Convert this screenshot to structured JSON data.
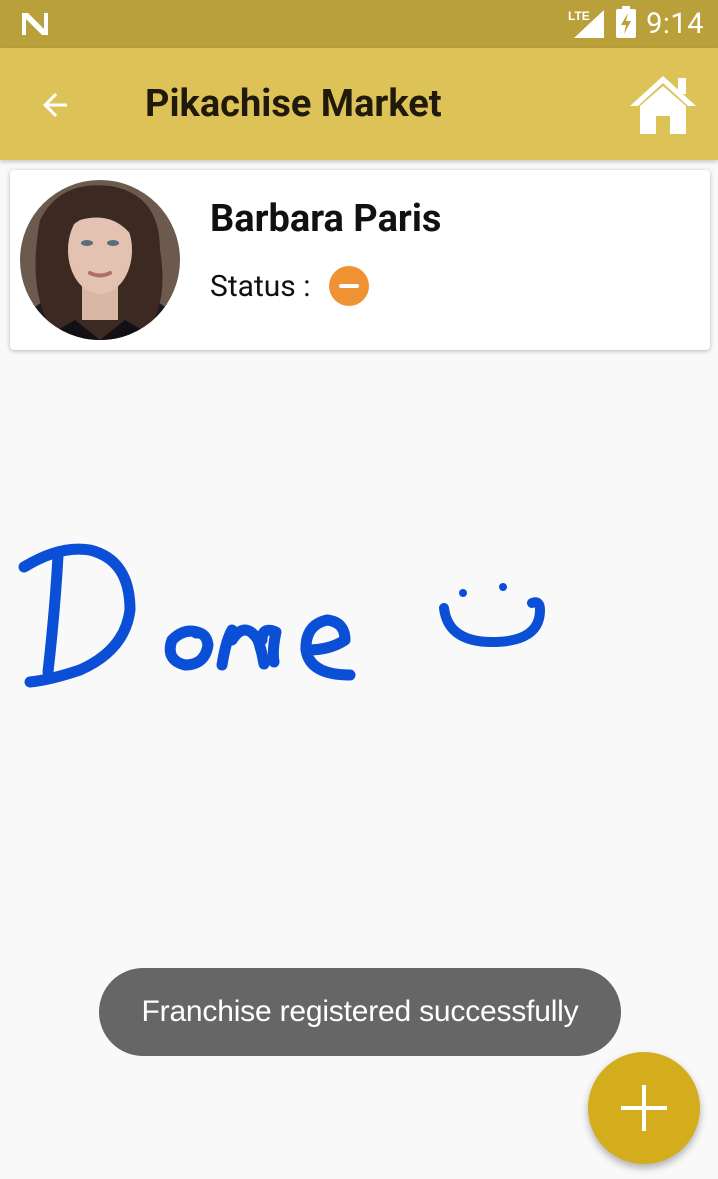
{
  "status_bar": {
    "network": "LTE",
    "time": "9:14"
  },
  "toolbar": {
    "title": "Pikachise Market"
  },
  "profile": {
    "name": "Barbara Paris",
    "status_label": "Status :",
    "status_color": "#ef9233"
  },
  "signature": {
    "text": "Done"
  },
  "toast": {
    "message": "Franchise registered successfully"
  },
  "icons": {
    "back": "arrow-back-icon",
    "home": "home-icon",
    "fab": "plus-icon",
    "status": "minus-circle-icon",
    "notification": "n-icon",
    "signal": "lte-signal-icon",
    "battery": "battery-charging-icon"
  },
  "colors": {
    "toolbar": "#dcc257",
    "status_bar": "#baa03a",
    "fab": "#d4ad1d",
    "ink": "#0b4fd6"
  }
}
